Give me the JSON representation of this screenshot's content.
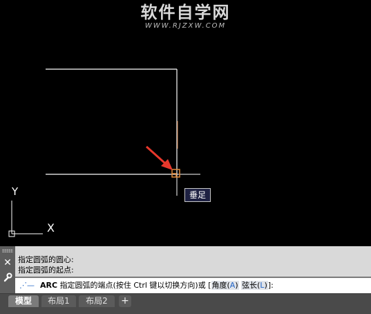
{
  "watermark": {
    "title": "软件自学网",
    "url": "WWW.RJZXW.COM"
  },
  "canvas": {
    "ucs_x_label": "X",
    "ucs_y_label": "Y",
    "snap_tooltip": "垂足",
    "colors": {
      "background": "#000000",
      "geometry": "#ffffff",
      "snap_marker": "#e08a3c",
      "arrow": "#e8382c"
    }
  },
  "command": {
    "close_icon": "close-icon",
    "settings_icon": "wrench-icon",
    "history": [
      "指定圆弧的圆心:",
      "指定圆弧的起点:"
    ],
    "prompt_icon": "command-prompt-icon",
    "prompt_command": "ARC",
    "prompt_text": "指定圆弧的端点(按住 Ctrl 键以切换方向)或 [",
    "option1_label": "角度(",
    "option1_key": "A",
    "option1_close": ")",
    "option2_label": "弦长(",
    "option2_key": "L",
    "option2_close": ")",
    "prompt_end": "]:"
  },
  "layout_tabs": {
    "tabs": [
      "模型",
      "布局1",
      "布局2"
    ],
    "active": "模型",
    "add_label": "+"
  }
}
